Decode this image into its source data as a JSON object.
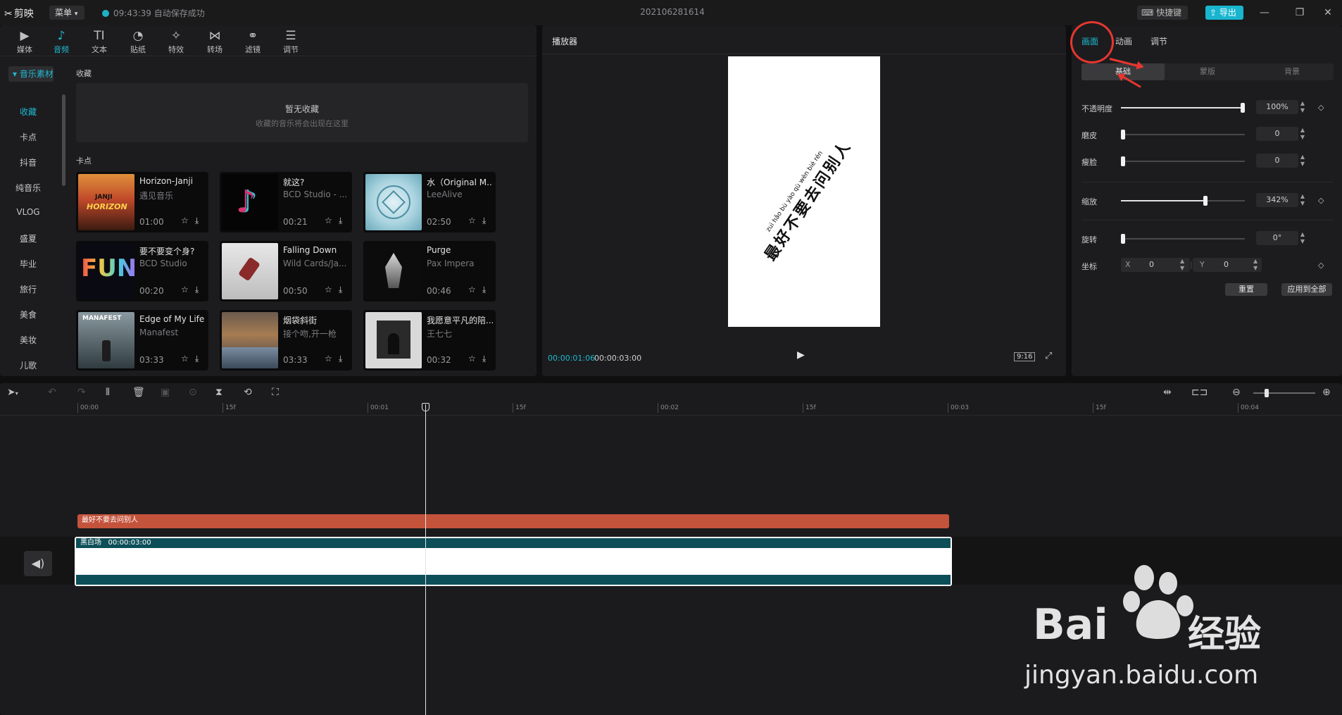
{
  "titlebar": {
    "app_name": "剪映",
    "menu_label": "菜单",
    "autosave_text": "09:43:39 自动保存成功",
    "project_title": "202106281614",
    "shortcut_label": "快捷键",
    "export_label": "导出"
  },
  "toolbar": {
    "tools": [
      {
        "label": "媒体",
        "icon": "media-icon",
        "glyph": "▶"
      },
      {
        "label": "音频",
        "icon": "audio-icon",
        "glyph": "♪"
      },
      {
        "label": "文本",
        "icon": "text-icon",
        "glyph": "TI"
      },
      {
        "label": "贴纸",
        "icon": "sticker-icon",
        "glyph": "◔"
      },
      {
        "label": "特效",
        "icon": "effects-icon",
        "glyph": "✧"
      },
      {
        "label": "转场",
        "icon": "transition-icon",
        "glyph": "⋈"
      },
      {
        "label": "滤镜",
        "icon": "filter-icon",
        "glyph": "⚭"
      },
      {
        "label": "调节",
        "icon": "adjust-icon",
        "glyph": "☰"
      }
    ]
  },
  "sidebar": {
    "header": "音乐素材",
    "items": [
      "收藏",
      "卡点",
      "抖音",
      "纯音乐",
      "VLOG",
      "盛夏",
      "毕业",
      "旅行",
      "美食",
      "美妆",
      "儿歌"
    ]
  },
  "media": {
    "favorites_title": "收藏",
    "favorites_empty": "暂无收藏",
    "favorites_hint": "收藏的音乐将会出现在这里",
    "beat_title": "卡点",
    "tracks": [
      {
        "title": "Horizon-Janji",
        "artist": "遇见音乐",
        "duration": "01:00"
      },
      {
        "title": "就这?",
        "artist": "BCD Studio - ...",
        "duration": "00:21"
      },
      {
        "title": "水（Original M...",
        "artist": "LeeAlive",
        "duration": "02:50"
      },
      {
        "title": "要不要变个身?",
        "artist": "BCD Studio",
        "duration": "00:20"
      },
      {
        "title": "Falling Down",
        "artist": "Wild Cards/Ja...",
        "duration": "00:50"
      },
      {
        "title": "Purge",
        "artist": "Pax Impera",
        "duration": "00:46"
      },
      {
        "title": "Edge of My Life",
        "artist": "Manafest",
        "duration": "03:33"
      },
      {
        "title": "烟袋斜街",
        "artist": "接个吻,开一枪",
        "duration": "03:33"
      },
      {
        "title": "我愿意平凡的陪...",
        "artist": "王七七",
        "duration": "00:32"
      }
    ],
    "thumb_texts": {
      "janji": "JANJI",
      "horizon": "HORIZON",
      "fun": "FUN",
      "manafest": "MANAFEST"
    }
  },
  "player": {
    "title": "播放器",
    "caption": "最好不要去问别人",
    "pinyin": "zuì hǎo bù yào qù wèn bié rén",
    "current_time": "00:00:01:06",
    "total_time": "00:00:03:00",
    "ratio": "9:16"
  },
  "props": {
    "tabs": [
      "画面",
      "动画",
      "调节"
    ],
    "sub_tabs": [
      "基础",
      "蒙版",
      "背景"
    ],
    "opacity": {
      "label": "不透明度",
      "value": "100%",
      "level": 1.0
    },
    "smooth": {
      "label": "磨皮",
      "value": "0",
      "level": 0.0
    },
    "slim": {
      "label": "瘦脸",
      "value": "0",
      "level": 0.0
    },
    "scale": {
      "label": "缩放",
      "value": "342%",
      "level": 0.68
    },
    "rotate": {
      "label": "旋转",
      "value": "0°",
      "level": 0.0
    },
    "position": {
      "label": "坐标",
      "x_label": "X",
      "x": "0",
      "y_label": "Y",
      "y": "0"
    },
    "reset_label": "重置",
    "apply_all_label": "应用到全部"
  },
  "timeline": {
    "ruler": [
      "00:00",
      "15f",
      "00:01",
      "15f",
      "00:02",
      "15f",
      "00:03",
      "15f",
      "00:04"
    ],
    "text_clip": "最好不要去问别人",
    "video_clip_name": "黑白场",
    "video_clip_duration": "00:00:03:00"
  },
  "watermark": {
    "brand": "Bai",
    "brand2": "经验",
    "url": "jingyan.baidu.com"
  },
  "colors": {
    "accent": "#1fb9d0",
    "text_clip": "#c4533c",
    "video_clip": "#0d4f58",
    "annotation": "#e8362f"
  }
}
